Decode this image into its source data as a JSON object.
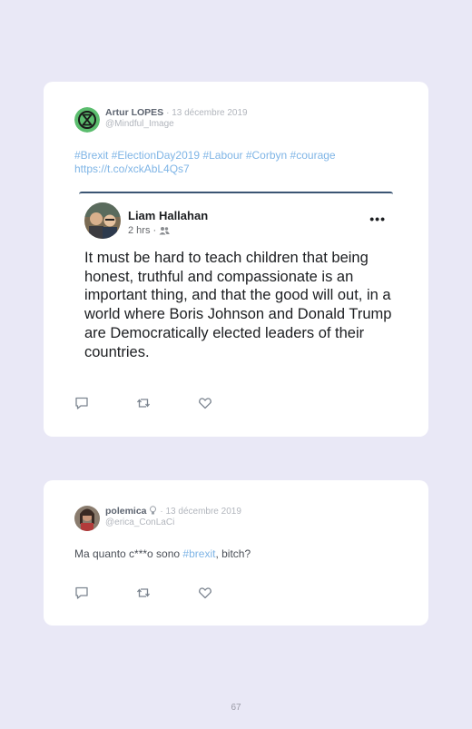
{
  "tweets": [
    {
      "author": "Artur LOPES",
      "date": "· 13 décembre 2019",
      "handle": "@Mindful_Image",
      "hashtags": [
        "#Brexit",
        "#ElectionDay2019",
        "#Labour",
        "#Corbyn",
        "#courage"
      ],
      "link": "https://t.co/xckAbL4Qs7",
      "avatar_icon": "extinction-symbol-icon",
      "embed": {
        "name": "Liam Hallahan",
        "time": "2 hrs ·",
        "audience_icon": "friends-icon",
        "more_icon": "•••",
        "text": "It must be hard to teach children that being honest, truthful and compassionate is an important thing, and that the good will out, in a world where Boris Johnson and Donald Trump are Democratically elected leaders of their countries."
      }
    },
    {
      "author": "polemica",
      "author_icon": "bulb-icon",
      "date": "· 13 décembre 2019",
      "handle": "@erica_ConLaCi",
      "text_before": "Ma quanto c***o sono ",
      "hashtag": "#brexit",
      "text_after": ", bitch?"
    }
  ],
  "action_icons": [
    "reply-icon",
    "retweet-icon",
    "like-icon"
  ],
  "page_number": "67",
  "colors": {
    "background": "#e9e8f6",
    "hashtag": "#7fb5e6",
    "name": "#5d6470",
    "muted": "#b2b6bd"
  }
}
